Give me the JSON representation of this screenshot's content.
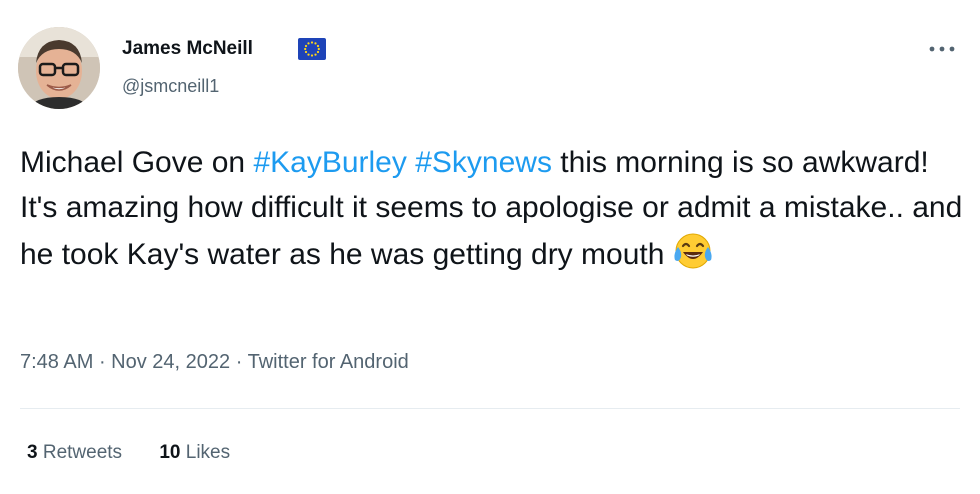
{
  "author": {
    "name": "James McNeill",
    "handle": "@jsmcneill1",
    "badge_icon": "eu-flag-icon"
  },
  "tweet": {
    "text_before": "Michael Gove on ",
    "hashtag_1": "#KayBurley",
    "space": " ",
    "hashtag_2": "#Skynews",
    "text_after": " this morning is so awkward! It's amazing how difficult it seems to apologise or admit a mistake.. and he took Kay's water as he was getting dry mouth",
    "emoji_icon": "face-with-tears-of-joy-icon"
  },
  "meta": {
    "time": "7:48 AM",
    "separator": " · ",
    "date": "Nov 24, 2022",
    "source": "Twitter for Android"
  },
  "stats": {
    "retweets_count": "3",
    "retweets_label": "Retweets",
    "likes_count": "10",
    "likes_label": "Likes"
  },
  "colors": {
    "link": "#1d9bf0",
    "secondary_text": "#536471",
    "primary_text": "#0f1419"
  },
  "more_icon": "more-options-icon"
}
